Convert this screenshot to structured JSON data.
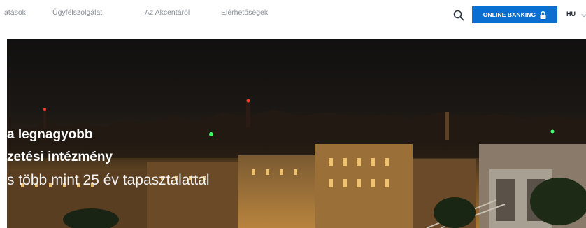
{
  "nav": {
    "links": [
      "atások",
      "Ügyfélszolgálat",
      "Az Akcentáról",
      "Elérhetőségek"
    ],
    "search_icon": "search-icon",
    "banking_label": "ONLINE BANKING",
    "banking_icon": "lock-icon",
    "language": "HU",
    "language_icon": "chevron-down-icon",
    "accent_color": "#0a6fd1"
  },
  "hero": {
    "line1": "a legnagyobb",
    "line2": "zetési intézmény",
    "line3": "s több mint 25 év tapasztalattal",
    "image": "Budapest night panorama with Chain Bridge"
  }
}
